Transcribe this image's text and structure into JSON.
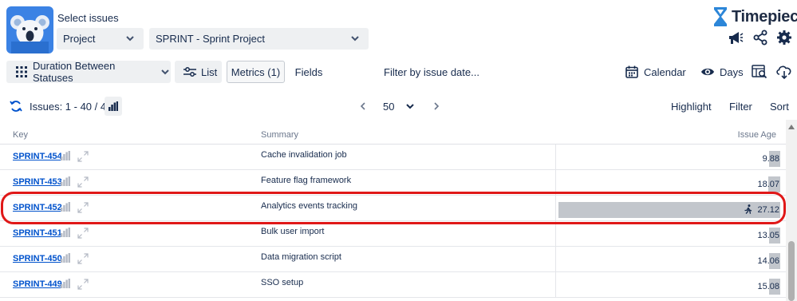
{
  "header": {
    "select_title": "Select issues",
    "project_dropdown": "Project",
    "sprint_dropdown": "SPRINT - Sprint Project",
    "brand_name": "Timepiece",
    "icons": [
      "megaphone-icon",
      "share-icon",
      "gear-icon"
    ]
  },
  "toolbar": {
    "report_type": "Duration Between Statuses",
    "list_label": "List",
    "metrics_label": "Metrics (1)",
    "fields_label": "Fields",
    "filter_label": "Filter by issue date...",
    "calendar_label": "Calendar",
    "days_label": "Days"
  },
  "pager": {
    "issues_label": "Issues: 1 - 40 / 40",
    "page_size": "50",
    "highlight_label": "Highlight",
    "filter_label": "Filter",
    "sort_label": "Sort"
  },
  "table": {
    "columns": [
      "Key",
      "Summary",
      "Issue Age"
    ],
    "rows": [
      {
        "key": "SPRINT-454",
        "summary": "Cache invalidation job",
        "age": "9.88",
        "age_value": 9.88
      },
      {
        "key": "SPRINT-453",
        "summary": "Feature flag framework",
        "age": "18.07",
        "age_value": 18.07
      },
      {
        "key": "SPRINT-452",
        "summary": "Analytics events tracking",
        "age": "27.12",
        "age_value": 27.12,
        "highlighted": true
      },
      {
        "key": "SPRINT-451",
        "summary": "Bulk user import",
        "age": "13.05",
        "age_value": 13.05
      },
      {
        "key": "SPRINT-450",
        "summary": "Data migration script",
        "age": "14.06",
        "age_value": 14.06
      },
      {
        "key": "SPRINT-449",
        "summary": "SSO setup",
        "age": "15.08",
        "age_value": 15.08
      }
    ]
  },
  "colors": {
    "accent": "#0052cc",
    "logo_bg": "#3b82e4",
    "age_bar": "#c2c6cc",
    "highlight_ring": "#e01818"
  }
}
